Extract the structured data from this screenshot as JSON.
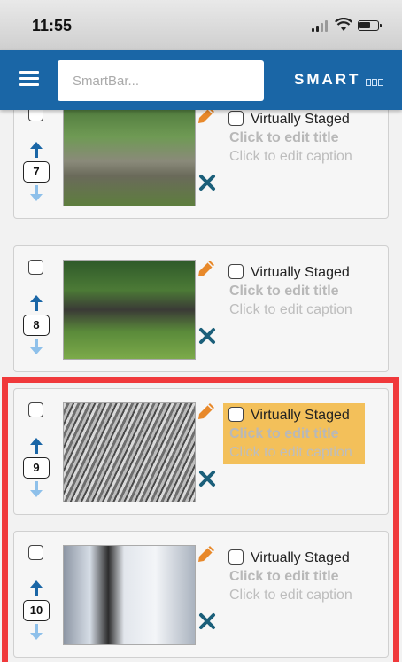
{
  "status_bar": {
    "time": "11:55"
  },
  "header": {
    "search_placeholder": "SmartBar...",
    "logo_text": "SMART"
  },
  "photos": [
    {
      "order": "7",
      "virtually_staged": "Virtually Staged",
      "title": "Click to edit title",
      "caption": "Click to edit caption",
      "highlighted": false
    },
    {
      "order": "8",
      "virtually_staged": "Virtually Staged",
      "title": "Click to edit title",
      "caption": "Click to edit caption",
      "highlighted": false
    },
    {
      "order": "9",
      "virtually_staged": "Virtually Staged",
      "title": "Click to edit title",
      "caption": "Click to edit caption",
      "highlighted": true
    },
    {
      "order": "10",
      "virtually_staged": "Virtually Staged",
      "title": "Click to edit title",
      "caption": "Click to edit caption",
      "highlighted": false
    }
  ],
  "colors": {
    "header_bg": "#1a66a6",
    "icon_accent": "#e8892b",
    "delete_icon": "#1b5f7a",
    "arrow_up": "#1a66a6",
    "arrow_down": "#8ec0ea",
    "highlight": "#f3c05a",
    "red_frame": "#f0393b"
  },
  "icons": {
    "menu": "hamburger-icon",
    "edit": "pencil-icon",
    "delete": "close-icon",
    "move_up": "arrow-up-icon",
    "move_down": "arrow-down-icon"
  }
}
